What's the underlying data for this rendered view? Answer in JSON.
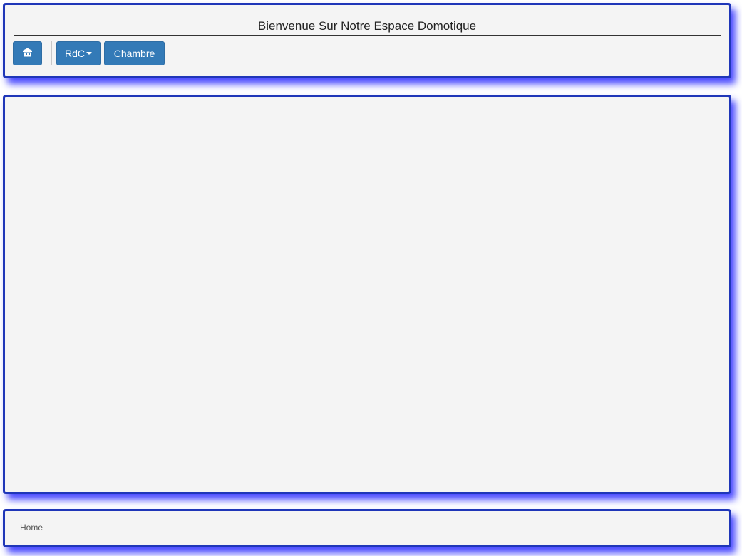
{
  "header": {
    "title": "Bienvenue Sur Notre Espace Domotique"
  },
  "nav": {
    "home_icon": "home-icon",
    "rdc_label": "RdC",
    "chambre_label": "Chambre"
  },
  "footer": {
    "text": "Home"
  },
  "colors": {
    "panel_border": "#1f36b8",
    "panel_shadow": "#2828ff",
    "panel_bg": "#f4f4f4",
    "button": "#337ab7"
  }
}
